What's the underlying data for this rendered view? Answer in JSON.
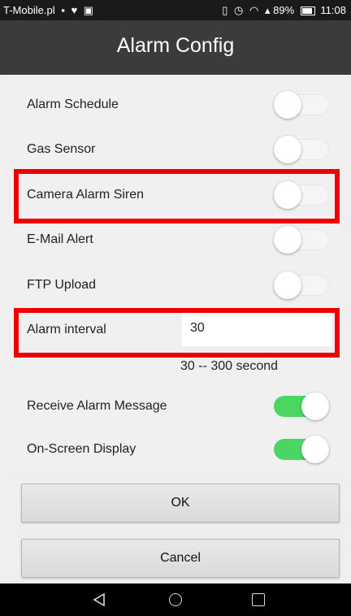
{
  "status_bar": {
    "carrier": "T-Mobile.pl",
    "battery": "89%",
    "time": "11:08"
  },
  "header": {
    "title": "Alarm Config"
  },
  "settings": [
    {
      "label": "Alarm Schedule",
      "on": false
    },
    {
      "label": "Gas Sensor",
      "on": false
    },
    {
      "label": "Camera Alarm Siren",
      "on": false
    },
    {
      "label": "E-Mail Alert",
      "on": false
    },
    {
      "label": "FTP Upload",
      "on": false
    }
  ],
  "interval": {
    "label": "Alarm interval",
    "value": "30",
    "range": "30 -- 300 second"
  },
  "messages": [
    {
      "label": "Receive Alarm Message",
      "on": true
    },
    {
      "label": "On-Screen Display",
      "on": true
    }
  ],
  "buttons": {
    "ok": "OK",
    "cancel": "Cancel"
  },
  "colors": {
    "toggle_on": "#4bd663",
    "highlight": "#ee0000",
    "title_bar": "#3b3b3b"
  }
}
